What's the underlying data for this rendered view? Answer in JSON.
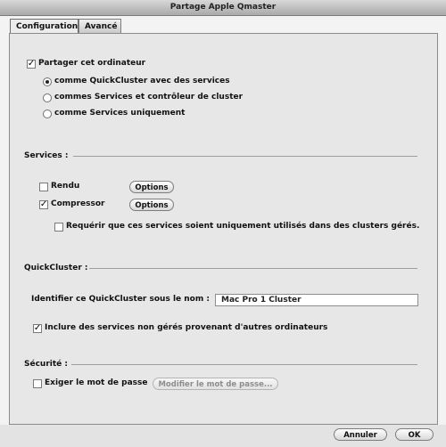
{
  "window": {
    "title": "Partage Apple Qmaster"
  },
  "tabs": [
    {
      "label": "Configuration",
      "active": true
    },
    {
      "label": "Avancé",
      "active": false
    }
  ],
  "sharing": {
    "share_label": "Partager cet ordinateur",
    "share_checked": true,
    "options": [
      {
        "label": "comme QuickCluster avec des services",
        "selected": true
      },
      {
        "label": "commes Services et contrôleur de cluster",
        "selected": false
      },
      {
        "label": "comme Services uniquement",
        "selected": false
      }
    ]
  },
  "services": {
    "heading": "Services :",
    "rendu_label": "Rendu",
    "rendu_checked": false,
    "compressor_label": "Compressor",
    "compressor_checked": true,
    "options_label": "Options",
    "require_label": "Requérir que ces services soient uniquement utilisés dans des clusters gérés.",
    "require_checked": false
  },
  "quickcluster": {
    "heading": "QuickCluster :",
    "name_label": "Identifier ce QuickCluster sous le nom :",
    "name_value": "Mac Pro 1 Cluster",
    "include_label": "Inclure des services non gérés provenant d'autres ordinateurs",
    "include_checked": true
  },
  "security": {
    "heading": "Sécurité :",
    "password_label": "Exiger le mot de passe",
    "password_checked": false,
    "modify_label": "Modifier le mot de passe..."
  },
  "footer": {
    "cancel_label": "Annuler",
    "ok_label": "OK"
  }
}
